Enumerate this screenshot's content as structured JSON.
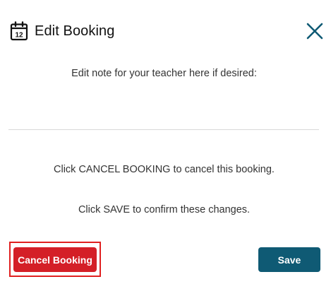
{
  "dialog": {
    "title": "Edit Booking",
    "calendar_icon_number": "12",
    "icons": {
      "header": "calendar-icon",
      "close": "close-icon"
    },
    "colors": {
      "close": "#0f5a74",
      "cancel": "#d41f27",
      "save": "#0f5a74",
      "highlight": "#e02020"
    }
  },
  "note": {
    "label": "Edit note for your teacher here if desired:",
    "value": "",
    "placeholder": ""
  },
  "messages": {
    "cancel_text": "Click CANCEL BOOKING to cancel this booking.",
    "save_text": "Click SAVE to confirm these changes."
  },
  "actions": {
    "cancel_label": "Cancel Booking",
    "save_label": "Save"
  }
}
